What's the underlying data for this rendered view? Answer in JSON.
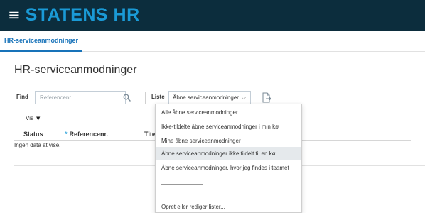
{
  "header": {
    "menu_icon": "hamburger-menu-icon",
    "brand": "STATENS HR",
    "brand_color": "#1a9ad6",
    "bar_color": "#0c2d3d"
  },
  "tabs": [
    {
      "label": "HR-serviceanmodninger",
      "active": true
    }
  ],
  "page": {
    "title": "HR-serviceanmodninger"
  },
  "filters": {
    "find_label": "Find",
    "find_placeholder": "Referencenr.",
    "search_icon": "search-icon",
    "list_label": "Liste",
    "list_value": "Åbne serviceanmodninger ikke",
    "export_icon": "export-icon"
  },
  "view": {
    "label": "Vis"
  },
  "table": {
    "columns": [
      {
        "label": "Status",
        "required": false
      },
      {
        "label": "Referencenr.",
        "required": true
      },
      {
        "label": "Tite",
        "required": false
      }
    ],
    "empty_text": "Ingen data at vise."
  },
  "list_menu": {
    "items": [
      {
        "label": "Alle åbne serviceanmodninger",
        "selected": false
      },
      {
        "label": "Ikke-tildelte åbne serviceanmodninger i min kø",
        "selected": false
      },
      {
        "label": "Mine åbne serviceanmodninger",
        "selected": false
      },
      {
        "label": "Åbne serviceanmodninger ikke tildelt til en kø",
        "selected": true
      },
      {
        "label": "Åbne serviceanmodninger, hvor jeg findes i teamet",
        "selected": false
      }
    ],
    "footer_item": "Opret eller rediger lister..."
  }
}
